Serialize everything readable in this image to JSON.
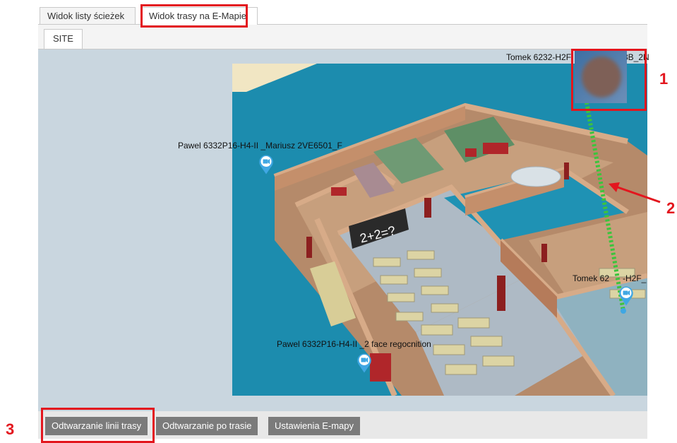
{
  "tabs": [
    {
      "label": "Widok listy ścieżek"
    },
    {
      "label": "Widok trasy na E-Mapie"
    }
  ],
  "subtab": {
    "label": "SITE"
  },
  "map": {
    "cameras": [
      {
        "label": "Tomek 6232-H2F",
        "label_tail": "3B_2N"
      },
      {
        "label": "Pawel  6332P16-H4-II _Mariusz 2VE6501_F"
      },
      {
        "label": "Tomek 62",
        "label_tail": "-H2F_"
      },
      {
        "label": "Pawel  6332P16-H4-II _2 face regocnition"
      }
    ],
    "board_text": "2+2=?",
    "route_color": "#3cc43c",
    "pin_color": "#3fa7e3"
  },
  "toolbar": {
    "buttons": [
      {
        "label": "Odtwarzanie linii trasy"
      },
      {
        "label": "Odtwarzanie po trasie"
      },
      {
        "label": "Ustawienia E-mapy"
      }
    ]
  },
  "annotations": {
    "accent": "#e3161e",
    "markers": [
      "1",
      "2",
      "3"
    ]
  }
}
